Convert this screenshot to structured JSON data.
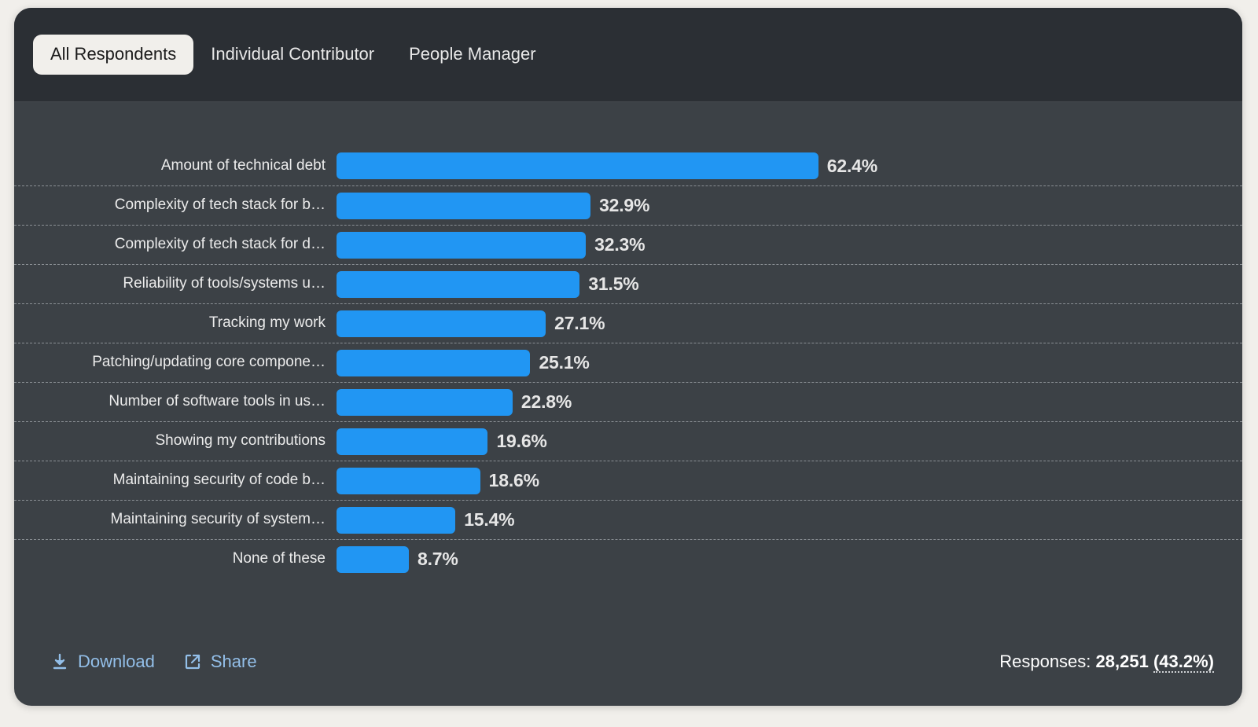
{
  "tabs": [
    {
      "label": "All Respondents",
      "active": true
    },
    {
      "label": "Individual Contributor",
      "active": false
    },
    {
      "label": "People Manager",
      "active": false
    }
  ],
  "footer": {
    "download_label": "Download",
    "share_label": "Share",
    "download_icon": "download-icon",
    "share_icon": "external-link-icon",
    "responses_label": "Responses:",
    "responses_count": "28,251",
    "responses_percent": "(43.2%)"
  },
  "colors": {
    "bar": "#2196f3",
    "card_bg": "#3c4146",
    "header_bg": "#2b2f34",
    "page_bg": "#f1efeb",
    "link": "#93bfe9",
    "active_tab_bg": "#f1efeb"
  },
  "chart_data": {
    "type": "bar",
    "orientation": "horizontal",
    "title": "",
    "xlabel": "",
    "ylabel": "",
    "xlim": [
      0,
      62.4
    ],
    "grid": "dashed-row-separators",
    "legend": "none",
    "value_suffix": "%",
    "categories": [
      "Amount of technical debt",
      "Complexity of tech stack for b…",
      "Complexity of tech stack for d…",
      "Reliability of tools/systems u…",
      "Tracking my work",
      "Patching/updating core compone…",
      "Number of software tools in us…",
      "Showing my contributions",
      "Maintaining security of code b…",
      "Maintaining security of system…",
      "None of these"
    ],
    "values": [
      62.4,
      32.9,
      32.3,
      31.5,
      27.1,
      25.1,
      22.8,
      19.6,
      18.6,
      15.4,
      8.7
    ],
    "labels": [
      "62.4%",
      "32.9%",
      "32.3%",
      "31.5%",
      "27.1%",
      "25.1%",
      "22.8%",
      "19.6%",
      "18.6%",
      "15.4%",
      "8.7%"
    ]
  }
}
